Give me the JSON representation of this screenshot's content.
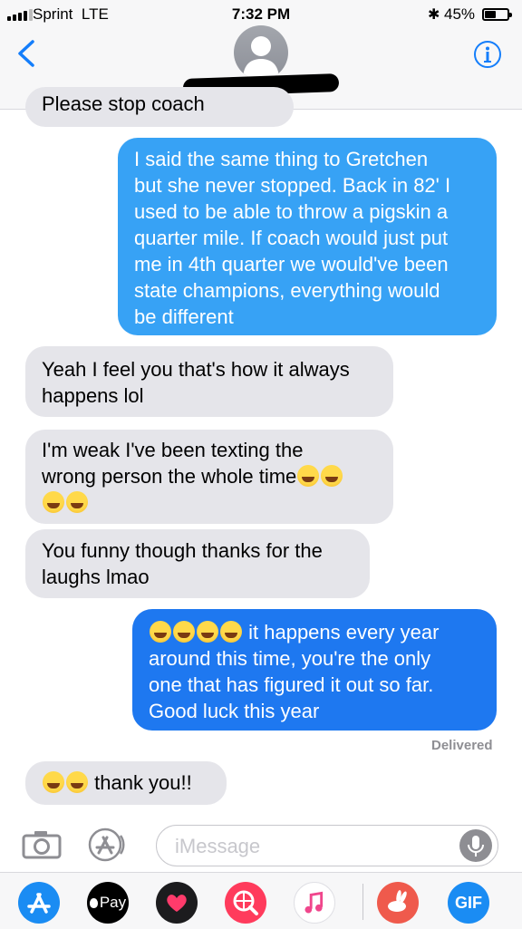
{
  "status_bar": {
    "carrier": "Sprint",
    "network": "LTE",
    "time": "7:32 PM",
    "battery": "45%"
  },
  "header": {
    "back_icon": "chevron-left-icon",
    "info_icon": "info-icon"
  },
  "messages": {
    "partial_top": "Please stop coach",
    "m1_lines": [
      "I said the same thing to Gretchen",
      "but she never stopped. Back in 82' I",
      "used to be able to throw a pigskin a",
      "quarter mile. If coach would just put",
      "me in 4th quarter we would've been",
      "state champions, everything would",
      "be different"
    ],
    "m2_lines": [
      "Yeah I feel you that's how it always",
      "happens lol"
    ],
    "m3_line1": "I'm weak I've been texting the",
    "m3_line2": "wrong person the whole time",
    "m4_lines": [
      "You funny though thanks for the",
      "laughs lmao"
    ],
    "m5_line1": "it happens every year",
    "m5_line2": "around this time, you're the only",
    "m5_line3": "one that has figured it out so far.",
    "m5_line4": "Good luck this year",
    "delivered": "Delivered",
    "m6_text": "thank you!!"
  },
  "input_bar": {
    "placeholder": "iMessage"
  },
  "app_drawer": {
    "apple_pay_label": "Pay",
    "gif_label": "GIF"
  },
  "colors": {
    "incoming": "#e5e5ea",
    "outgoing": "#37a2f5",
    "outgoing_dark": "#1e78f0",
    "accent": "#147efb"
  }
}
